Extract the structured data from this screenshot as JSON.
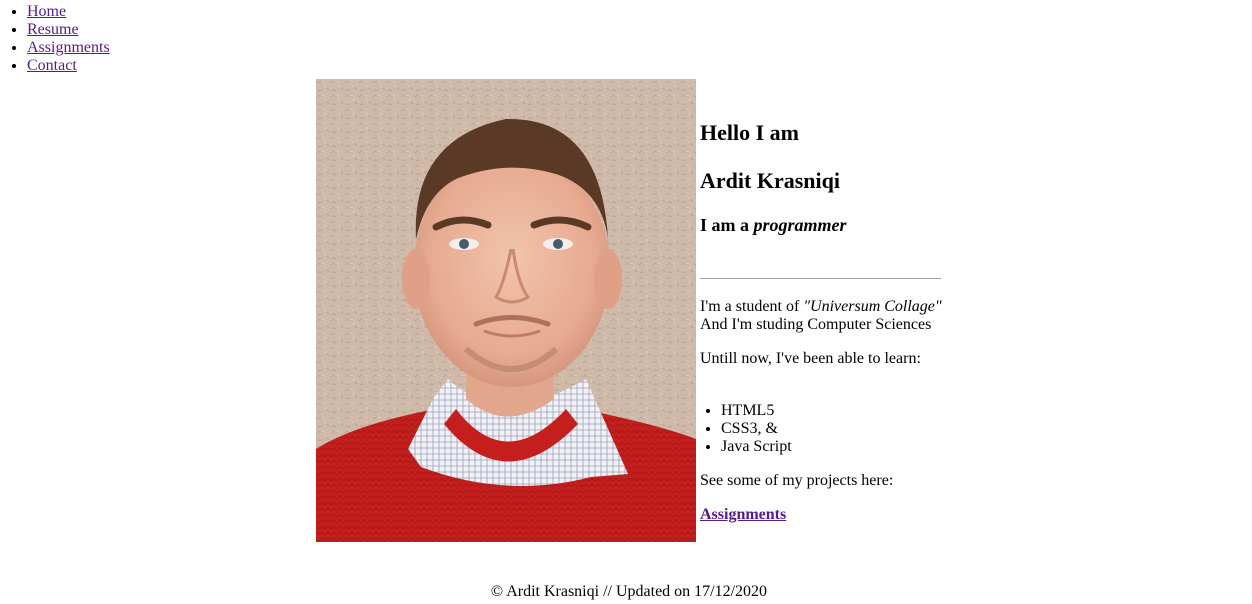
{
  "nav": {
    "items": [
      {
        "label": "Home"
      },
      {
        "label": "Resume"
      },
      {
        "label": "Assignments"
      },
      {
        "label": "Contact"
      }
    ]
  },
  "intro": {
    "greeting": "Hello I am",
    "name": "Ardit Krasniqi",
    "role_prefix": "I am a ",
    "role": "programmer",
    "student_prefix": "I'm a student of ",
    "school": "\"Universum Collage\"",
    "studying": "And I'm studing Computer Sciences",
    "learned_intro": "Untill now, I've been able to learn:",
    "skills": [
      "HTML5",
      "CSS3, &",
      "Java Script"
    ],
    "projects_text": "See some of my projects here:",
    "projects_link": "Assignments"
  },
  "footer": {
    "text": "© Ardit Krasniqi // Updated on 17/12/2020"
  },
  "colors": {
    "link": "#551a8b",
    "divider": "#a0a0a0",
    "sweater": "#c8201f",
    "wall": "#cdb8a8"
  }
}
